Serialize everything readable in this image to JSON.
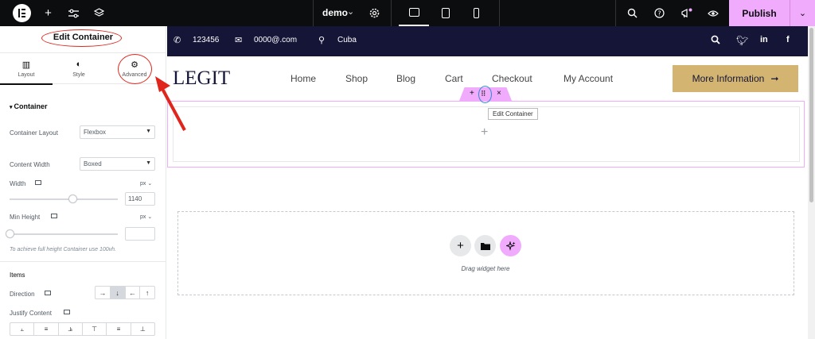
{
  "topbar": {
    "logo_icon": "elementor-logo-icon",
    "add_icon": "plus-icon",
    "settings_icon": "sliders-icon",
    "structure_icon": "layers-icon",
    "site_name": "demo",
    "site_caret": "⌄",
    "site_settings_icon": "gear-icon",
    "devices": [
      "desktop-icon",
      "tablet-icon",
      "mobile-icon"
    ],
    "search_icon": "search-icon",
    "help_icon": "help-icon",
    "notifications_icon": "megaphone-icon",
    "preview_icon": "eye-icon",
    "publish_label": "Publish",
    "publish_more": "⌄",
    "accent": "#f0abfc"
  },
  "panel": {
    "title": "Edit Container",
    "tabs": [
      {
        "icon": "layout-icon",
        "glyph": "▥",
        "label": "Layout"
      },
      {
        "icon": "style-icon",
        "glyph": "◐",
        "label": "Style"
      },
      {
        "icon": "gear-icon",
        "glyph": "⚙",
        "label": "Advanced"
      }
    ],
    "section": "Container",
    "container_layout_label": "Container Layout",
    "container_layout_value": "Flexbox",
    "content_width_label": "Content Width",
    "content_width_value": "Boxed",
    "width_label": "Width",
    "width_unit": "px",
    "width_value": "1140",
    "width_slider_fraction": 0.58,
    "min_height_label": "Min Height",
    "min_height_unit": "px",
    "min_height_value": "",
    "min_height_slider_fraction": 0.0,
    "note": "To achieve full height Container use 100vh.",
    "items_heading": "Items",
    "direction_label": "Direction",
    "direction_options": [
      "→",
      "↓",
      "←",
      "↑"
    ],
    "direction_selected": "↓",
    "justify_label": "Justify Content",
    "justify_options": [
      "⫠",
      "≡",
      "⫡",
      "⊤",
      "≡",
      "⊥"
    ]
  },
  "site": {
    "phone": "123456",
    "email": "0000@.com",
    "location": "Cuba",
    "social_icons": [
      "search-icon",
      "twitter-icon",
      "linkedin-icon",
      "facebook-icon"
    ],
    "brand": "LEGIT",
    "nav": [
      "Home",
      "Shop",
      "Blog",
      "Cart",
      "Checkout",
      "My Account"
    ],
    "cta": "More Information",
    "cta_arrow": "➞",
    "dark": "#151538",
    "gold": "#d3b571"
  },
  "editor": {
    "handle_add": "+",
    "handle_move": "⠿",
    "handle_close": "×",
    "tooltip": "Edit Container",
    "drop_label": "Drag widget here",
    "drop_buttons": [
      "plus-icon",
      "folder-icon",
      "ai-sparkle-icon"
    ]
  }
}
